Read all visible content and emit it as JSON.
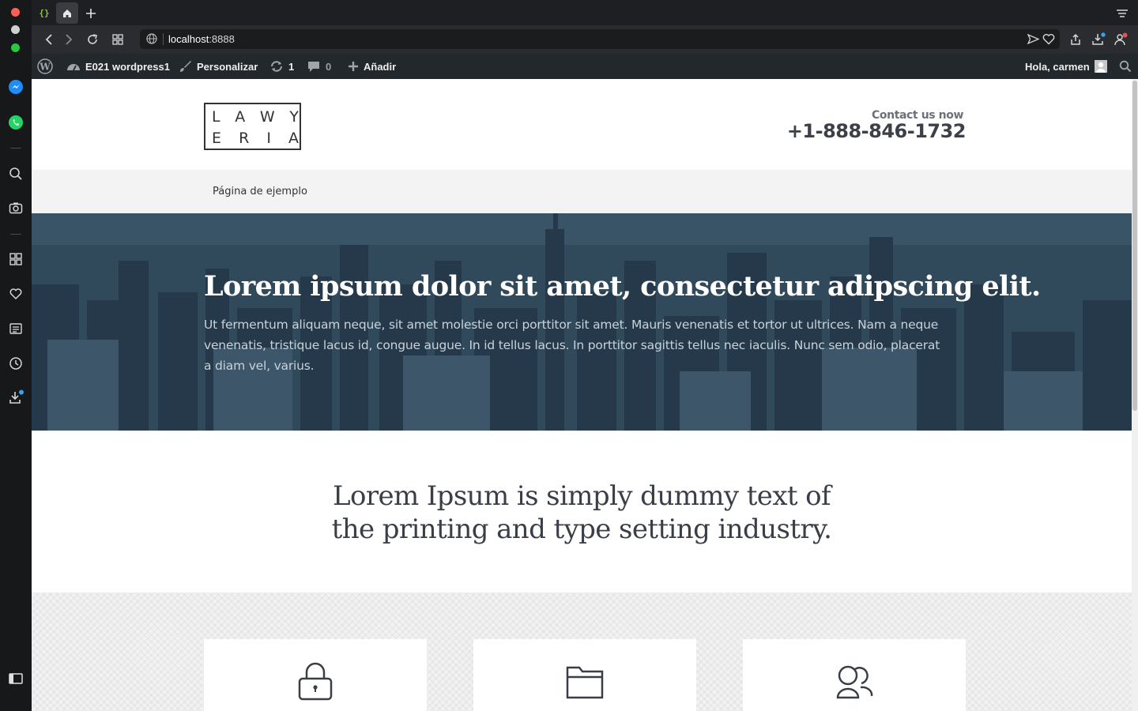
{
  "browser": {
    "url_host": "localhost",
    "url_port": ":8888"
  },
  "adminbar": {
    "site_name": "E021 wordpress1",
    "customize": "Personalizar",
    "updates_count": "1",
    "comments_count": "0",
    "new_label": "Añadir",
    "greeting": "Hola, carmen"
  },
  "site": {
    "logo_row1": [
      "L",
      "A",
      "W",
      "Y"
    ],
    "logo_row2": [
      "E",
      "R",
      "I",
      "A"
    ],
    "contact_label": "Contact us now",
    "contact_phone": "+1-888-846-1732",
    "menu_item": "Página de ejemplo"
  },
  "hero": {
    "title": "Lorem ipsum dolor sit amet, consectetur adipscing elit.",
    "text": "Ut fermentum aliquam neque, sit amet molestie orci porttitor sit amet. Mauris venenatis et tortor ut ultrices. Nam a neque venenatis, tristique lacus id, congue augue. In id tellus lacus. In porttitor sagittis tellus nec iaculis. Nunc sem odio, placerat a diam vel, varius."
  },
  "intro": {
    "line1": "Lorem Ipsum is simply dummy text of",
    "line2": "the printing and type setting industry."
  },
  "features": {
    "icons": [
      "lock-icon",
      "folder-icon",
      "users-icon"
    ]
  },
  "colors": {
    "adminbar_bg": "#23282d",
    "hero_overlay": "#2e4556",
    "menubar_bg": "#f3f3f3"
  }
}
